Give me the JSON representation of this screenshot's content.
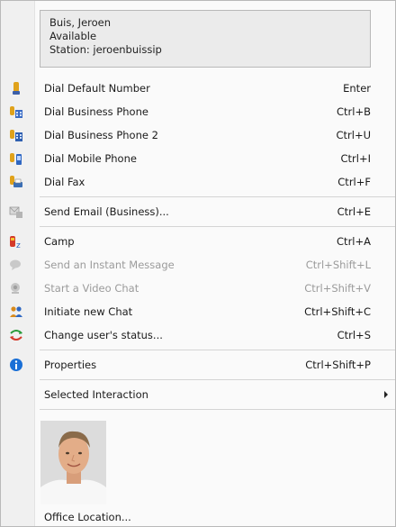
{
  "contact": {
    "name": "Buis, Jeroen",
    "status": "Available",
    "station": "Station: jeroenbuissip"
  },
  "menu": {
    "dial_default": {
      "label": "Dial Default Number",
      "shortcut": "Enter",
      "icon": "phone-icon"
    },
    "dial_business": {
      "label": "Dial Business Phone",
      "shortcut": "Ctrl+B",
      "icon": "business-phone-icon"
    },
    "dial_business2": {
      "label": "Dial Business Phone 2",
      "shortcut": "Ctrl+U",
      "icon": "business-phone-2-icon"
    },
    "dial_mobile": {
      "label": "Dial Mobile Phone",
      "shortcut": "Ctrl+I",
      "icon": "mobile-phone-icon"
    },
    "dial_fax": {
      "label": "Dial Fax",
      "shortcut": "Ctrl+F",
      "icon": "fax-icon"
    },
    "send_email": {
      "label": "Send Email (Business)...",
      "shortcut": "Ctrl+E",
      "icon": "email-icon"
    },
    "camp": {
      "label": "Camp",
      "shortcut": "Ctrl+A",
      "icon": "camp-icon"
    },
    "send_im": {
      "label": "Send an Instant Message",
      "shortcut": "Ctrl+Shift+L",
      "icon": "instant-message-icon"
    },
    "video_chat": {
      "label": "Start a Video Chat",
      "shortcut": "Ctrl+Shift+V",
      "icon": "video-chat-icon"
    },
    "new_chat": {
      "label": "Initiate new Chat",
      "shortcut": "Ctrl+Shift+C",
      "icon": "chat-icon"
    },
    "change_status": {
      "label": "Change user's status...",
      "shortcut": "Ctrl+S",
      "icon": "change-status-icon"
    },
    "properties": {
      "label": "Properties",
      "shortcut": "Ctrl+Shift+P",
      "icon": "info-icon"
    },
    "selected_interaction": {
      "label": "Selected Interaction"
    }
  },
  "office_location": "Office Location...",
  "colors": {
    "gutter": "#f0f0f0",
    "card": "#ebebeb",
    "disabled_text": "#9b9b9b",
    "info_blue": "#1a6fd6"
  }
}
